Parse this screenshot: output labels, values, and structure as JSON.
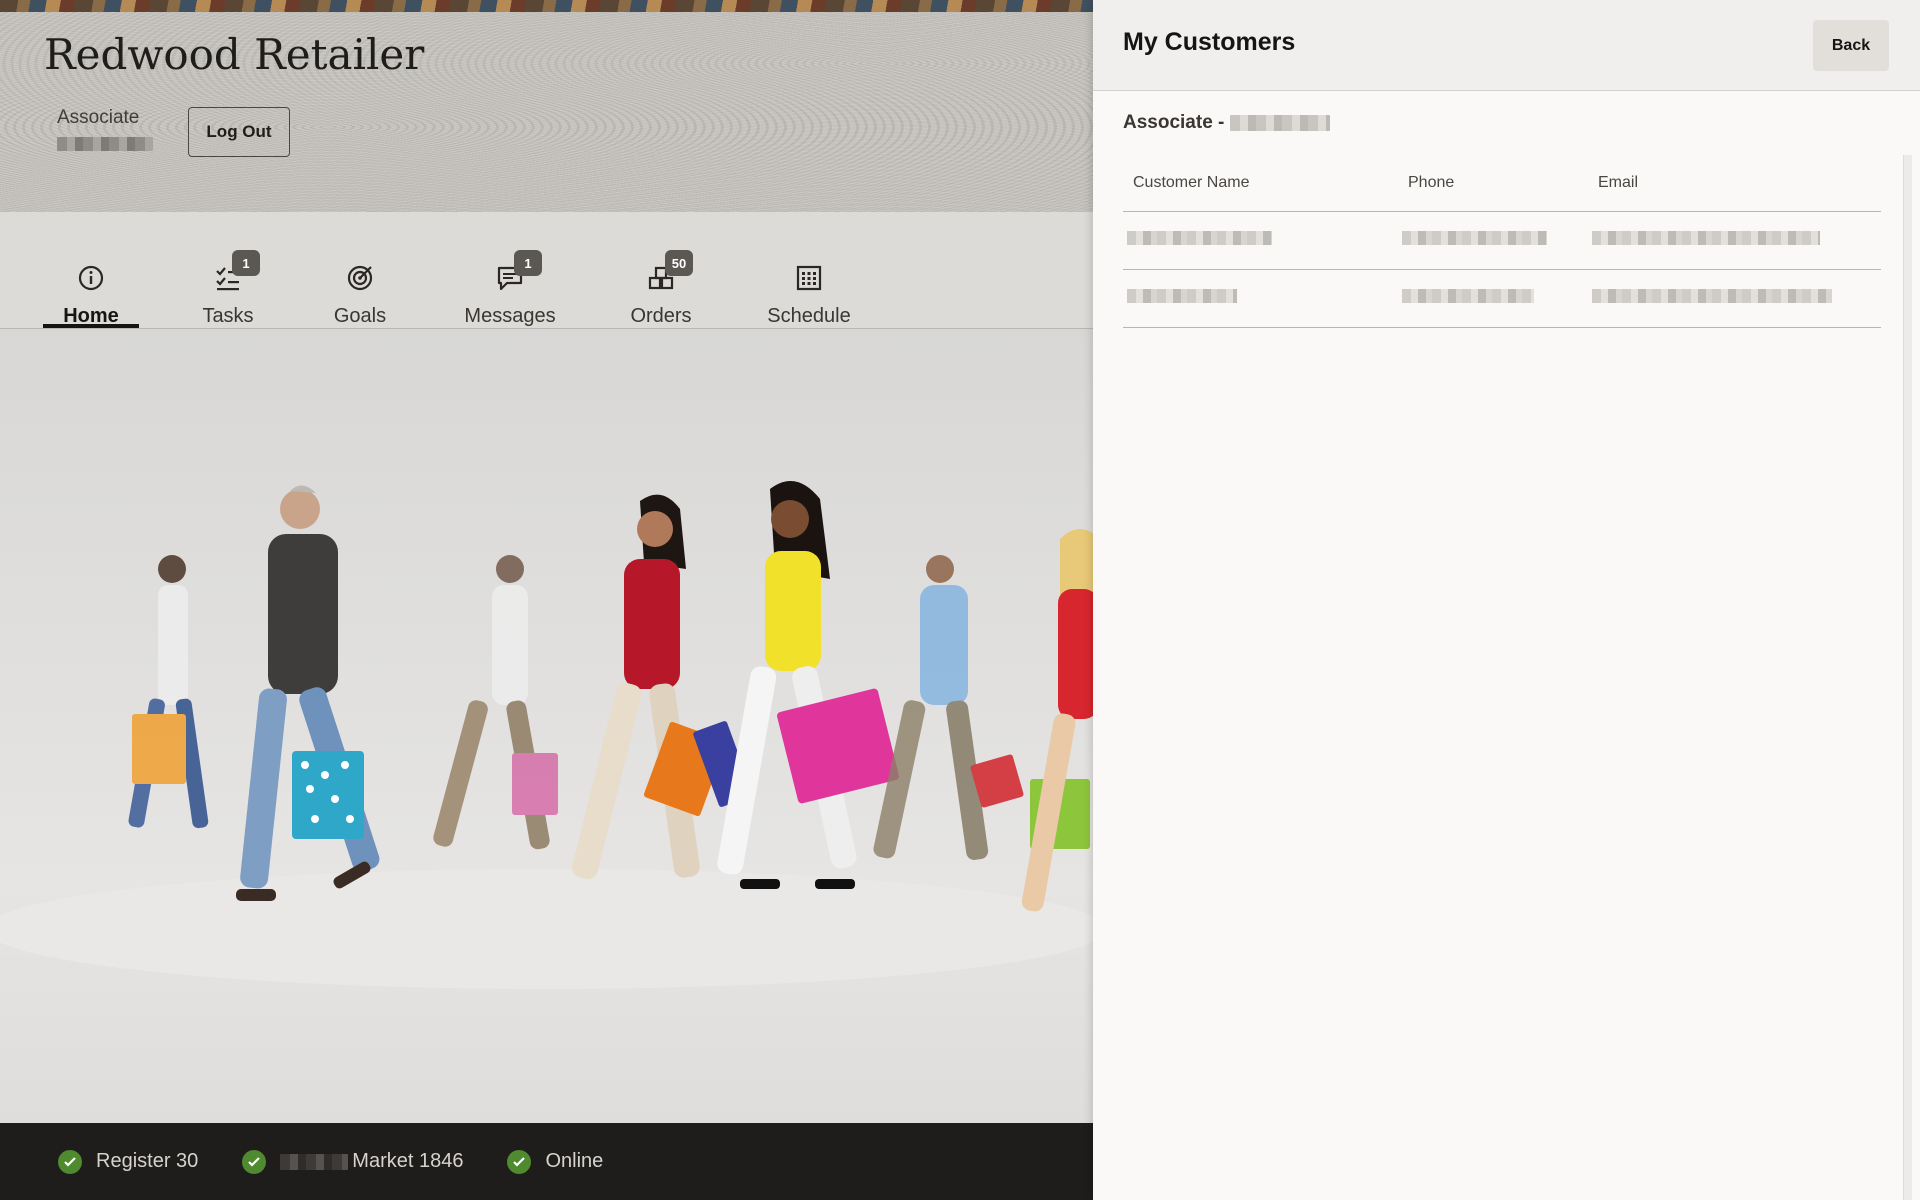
{
  "app": {
    "title": "Redwood Retailer",
    "associate_label": "Associate",
    "logout_label": "Log Out"
  },
  "nav": {
    "items": [
      {
        "label": "Home",
        "icon": "info-icon",
        "badge": null,
        "active": true
      },
      {
        "label": "Tasks",
        "icon": "tasks-icon",
        "badge": "1",
        "active": false
      },
      {
        "label": "Goals",
        "icon": "target-icon",
        "badge": null,
        "active": false
      },
      {
        "label": "Messages",
        "icon": "message-icon",
        "badge": "1",
        "active": false
      },
      {
        "label": "Orders",
        "icon": "orders-icon",
        "badge": "50",
        "active": false
      },
      {
        "label": "Schedule",
        "icon": "calendar-icon",
        "badge": null,
        "active": false
      }
    ]
  },
  "status_bar": {
    "register": "Register 30",
    "store": "Market 1846",
    "connection": "Online"
  },
  "drawer": {
    "title": "My Customers",
    "back_label": "Back",
    "associate_prefix": "Associate -",
    "columns": [
      "Customer Name",
      "Phone",
      "Email"
    ]
  },
  "colors": {
    "status_ok": "#4f8a2f",
    "status_bar_bg": "#1f1d1c",
    "badge_bg": "#5b5753"
  }
}
